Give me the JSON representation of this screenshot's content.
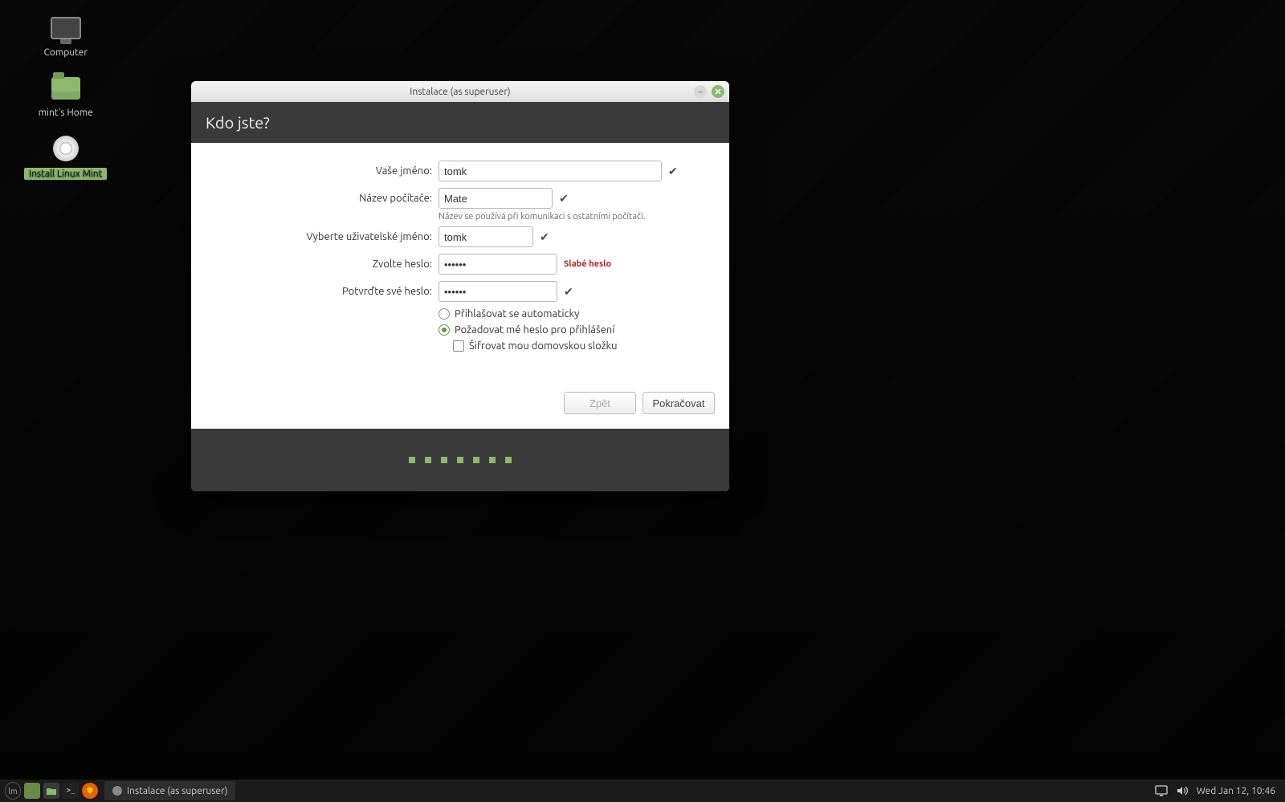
{
  "desktop": {
    "icons": [
      {
        "id": "computer",
        "label": "Computer"
      },
      {
        "id": "home",
        "label": "mint's Home"
      },
      {
        "id": "install",
        "label": "Install Linux Mint"
      }
    ]
  },
  "window": {
    "title": "Instalace (as superuser)",
    "heading": "Kdo jste?",
    "labels": {
      "name": "Vaše jméno:",
      "hostname": "Název počítače:",
      "hostname_hint": "Název se používá při komunikaci s ostatními počítači.",
      "username": "Vyberte uživatelské jméno:",
      "password": "Zvolte heslo:",
      "password_weak": "Slabé heslo",
      "confirm": "Potvrďte své heslo:",
      "auto_login": "Přihlašovat se automaticky",
      "require_pw": "Požadovat mé heslo pro přihlášení",
      "encrypt": "Šifrovat mou domovskou složku"
    },
    "values": {
      "name": "tomk",
      "hostname": "Mate",
      "username": "tomk",
      "password": "••••••",
      "confirm": "••••••"
    },
    "login_option": "require_pw",
    "encrypt_home": false,
    "buttons": {
      "back": "Zpět",
      "continue": "Pokračovat"
    },
    "progress_dots": 7
  },
  "taskbar": {
    "active_task": "Instalace (as superuser)",
    "clock": "Wed Jan 12, 10:46"
  }
}
